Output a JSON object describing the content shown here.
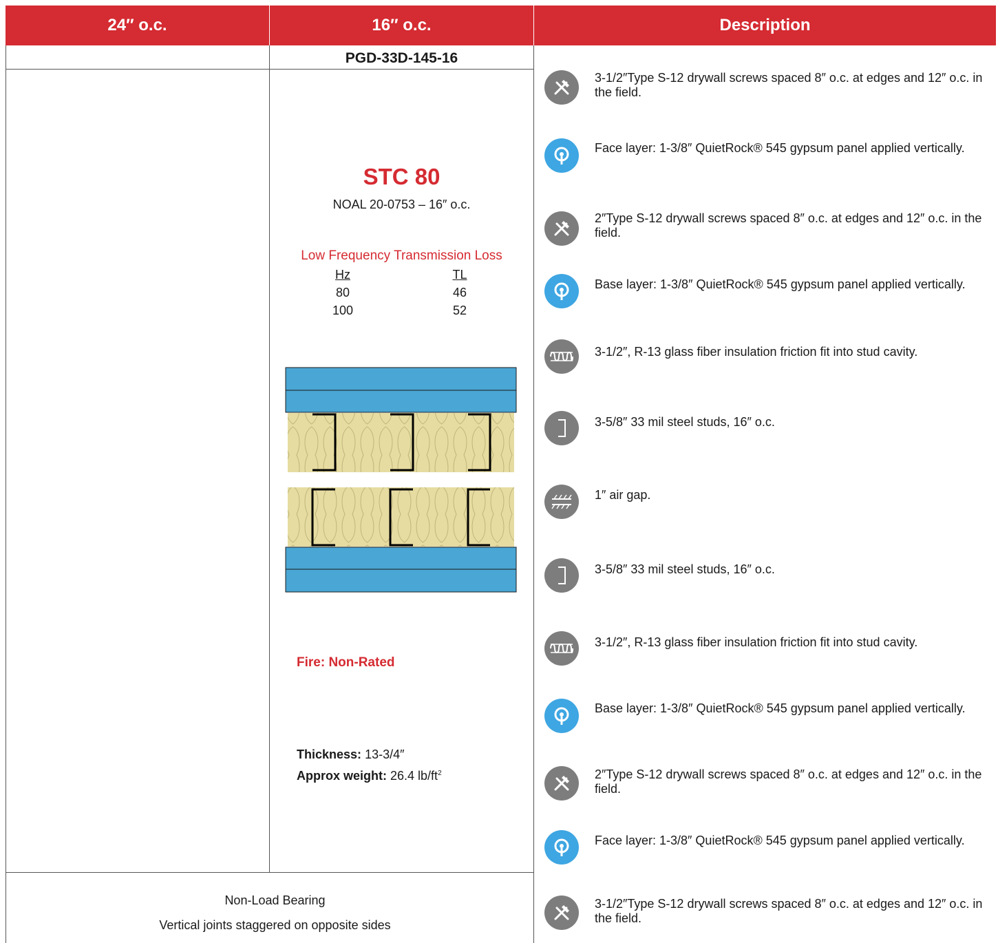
{
  "header": {
    "col_24": "24″ o.c.",
    "col_16": "16″ o.c.",
    "col_desc": "Description"
  },
  "assembly": {
    "code": "PGD-33D-145-16",
    "stc": "STC 80",
    "noal": "NOAL 20-0753 – 16″ o.c.",
    "lftl_title": "Low Frequency Transmission Loss",
    "lftl": {
      "hz_header": "Hz",
      "tl_header": "TL",
      "hz": [
        "80",
        "100"
      ],
      "tl": [
        "46",
        "52"
      ]
    },
    "fire": "Fire: Non-Rated",
    "thickness_label": "Thickness:",
    "thickness_value": "13-3/4″",
    "weight_label": "Approx weight:",
    "weight_value": "26.4 lb/ft",
    "weight_sup": "2"
  },
  "footer": {
    "line1": "Non-Load Bearing",
    "line2": "Vertical joints staggered on opposite sides"
  },
  "colors": {
    "brand_red": "#d52b32",
    "panel_blue": "#4aa6d4",
    "insulation": "#e6dca1",
    "icon_grey": "#7d7d7d",
    "icon_blue": "#3ea6e2"
  },
  "description": [
    {
      "icon": "screw-icon",
      "text": "3-1/2″Type S-12 drywall screws spaced 8″ o.c. at edges and 12″ o.c. in the field."
    },
    {
      "icon": "quietrock-panel-icon",
      "text": "Face layer: 1-3/8″ QuietRock® 545 gypsum panel applied vertically."
    },
    {
      "icon": "screw-icon",
      "text": "2″Type S-12 drywall screws spaced 8″ o.c. at edges and 12″ o.c. in the field."
    },
    {
      "icon": "quietrock-panel-icon",
      "text": "Base layer: 1-3/8″ QuietRock® 545 gypsum panel applied vertically."
    },
    {
      "icon": "insulation-icon",
      "text": "3-1/2″, R-13 glass fiber insulation friction fit into stud cavity."
    },
    {
      "icon": "steel-stud-icon",
      "text": "3-5/8″ 33 mil steel studs, 16″ o.c."
    },
    {
      "icon": "air-gap-icon",
      "text": "1″ air gap."
    },
    {
      "icon": "steel-stud-icon",
      "text": "3-5/8″ 33 mil steel studs, 16″ o.c."
    },
    {
      "icon": "insulation-icon",
      "text": "3-1/2″, R-13 glass fiber insulation friction fit into stud cavity."
    },
    {
      "icon": "quietrock-panel-icon",
      "text": "Base layer: 1-3/8″ QuietRock® 545 gypsum panel applied vertically."
    },
    {
      "icon": "screw-icon",
      "text": "2″Type S-12 drywall screws spaced 8″ o.c. at edges and 12″ o.c. in the field."
    },
    {
      "icon": "quietrock-panel-icon",
      "text": "Face layer: 1-3/8″ QuietRock® 545 gypsum panel applied vertically."
    },
    {
      "icon": "screw-icon",
      "text": "3-1/2″Type S-12 drywall screws spaced 8″ o.c. at edges and 12″ o.c. in the field."
    }
  ]
}
